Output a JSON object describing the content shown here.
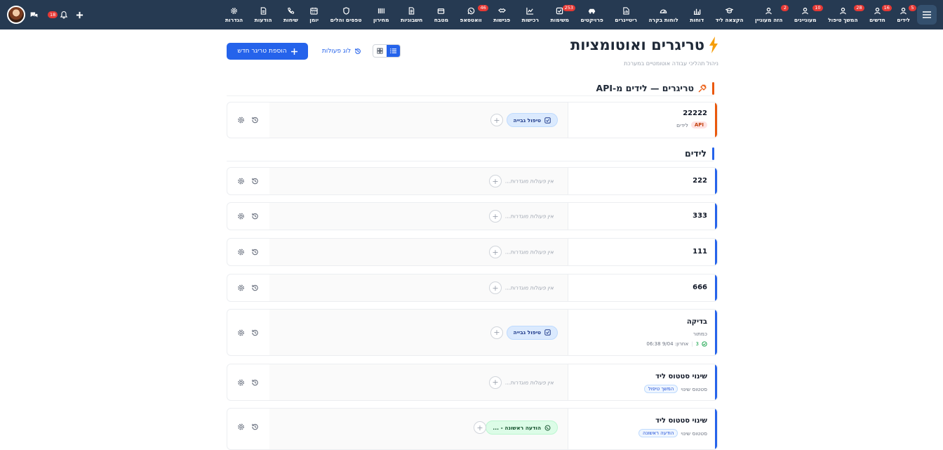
{
  "nav": {
    "items": [
      {
        "label": "לידים",
        "icon": "user-group-icon",
        "badge": "5"
      },
      {
        "label": "חדשים",
        "icon": "user-group-icon",
        "badge": "16"
      },
      {
        "label": "המשך טיפול",
        "icon": "user-group-icon",
        "badge": "28"
      },
      {
        "label": "מעוניינים",
        "icon": "user-group-icon",
        "badge": "10"
      },
      {
        "label": "הזה מעוניין",
        "icon": "user-group-icon",
        "badge": "2"
      },
      {
        "label": "הקצאה ליד",
        "icon": "hat-icon",
        "badge": ""
      },
      {
        "label": "דוחות",
        "icon": "bar-chart-icon",
        "badge": ""
      },
      {
        "label": "לוחות בקרה",
        "icon": "gauge-icon",
        "badge": ""
      },
      {
        "label": "ריטיינרים",
        "icon": "file-chart-icon",
        "badge": ""
      },
      {
        "label": "פרויקטים",
        "icon": "car-icon",
        "badge": ""
      },
      {
        "label": "משימות",
        "icon": "checkbox-icon",
        "badge": "253"
      },
      {
        "label": "רכישות",
        "icon": "chart-line-icon",
        "badge": ""
      },
      {
        "label": "פגישות",
        "icon": "handshake-icon",
        "badge": ""
      },
      {
        "label": "וואטסאפ",
        "icon": "whatsapp-icon",
        "badge": "46"
      },
      {
        "label": "מטבח",
        "icon": "box-icon",
        "badge": ""
      },
      {
        "label": "חשבוניות",
        "icon": "invoice-icon",
        "badge": ""
      },
      {
        "label": "מחירון",
        "icon": "barcode-icon",
        "badge": ""
      },
      {
        "label": "טפסים והלים",
        "icon": "shield-icon",
        "badge": ""
      },
      {
        "label": "יומן",
        "icon": "calendar-icon",
        "badge": ""
      },
      {
        "label": "שיחות",
        "icon": "phone-icon",
        "badge": ""
      },
      {
        "label": "הודעות",
        "icon": "document-icon",
        "badge": ""
      },
      {
        "label": "הגדרות",
        "icon": "gear-icon",
        "badge": ""
      }
    ],
    "notif_badge": "18"
  },
  "page": {
    "title": "טריגרים ואוטומציות",
    "subtitle": "ניהול תהליכי עבודה אוטומטיים במערכת",
    "add_button": "הוספת טריגר חדש",
    "log_button": "לוג פעולות"
  },
  "sections": {
    "api": {
      "title": "טריגרים — לידים מ-API"
    },
    "leads": {
      "title": "לידים"
    }
  },
  "cards": {
    "c1": {
      "name": "22222",
      "tag": "API",
      "sub": "לידים",
      "chip": "טיפול גבייה"
    },
    "c2": {
      "name": "222",
      "noact": "אין פעולות מוגדרות..."
    },
    "c3": {
      "name": "333",
      "noact": "אין פעולות מוגדרות..."
    },
    "c4": {
      "name": "111",
      "noact": "אין פעולות מוגדרות..."
    },
    "c5": {
      "name": "666",
      "noact": "אין פעולות מוגדרות..."
    },
    "c6": {
      "name": "בדיקה",
      "sub": "כמתור",
      "meta_count": "3",
      "meta_time": "אחרון: 9/04 06:38",
      "chip": "טיפול גבייה"
    },
    "c7": {
      "name": "שינוי סטטוס ליד",
      "sub": "סטטוס שינוי",
      "tag": "המשך טיפול",
      "noact": "אין פעולות מוגדרות..."
    },
    "c8": {
      "name": "שינוי סטטוס ליד",
      "sub": "סטטוס שינוי",
      "tag": "הודעה ראשונה",
      "chip": "הודעה ראשונה - ..."
    }
  },
  "colors": {
    "accent": "#2563eb",
    "api": "#ea580c",
    "topbar": "#263a52"
  }
}
